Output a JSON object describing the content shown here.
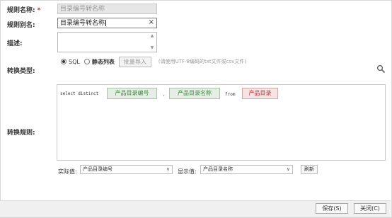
{
  "form": {
    "rule_name": {
      "label": "规则名称:",
      "required_mark": "*",
      "value": "目录编号转名称"
    },
    "rule_alias": {
      "label": "规则别名:",
      "value": "目录编号转名称",
      "clear": "×"
    },
    "description": {
      "label": "描述:",
      "value": ""
    },
    "convert_type": {
      "label": "转换类型:",
      "options": [
        "SQL",
        "静态列表"
      ],
      "selected": "SQL",
      "import_button": "批量导入",
      "hint": "(请使用UTF-8编码的txt文件或csv文件)"
    },
    "convert_rule": {
      "label": "转换规则:",
      "sql_keyword_select": "select distinct",
      "tag_field1": "产品目录编号",
      "comma": ",",
      "tag_field2": "产品目录名称",
      "sql_keyword_from": "from",
      "tag_table": "产品目录"
    },
    "actual_value": {
      "label": "实际值:",
      "value": "产品目录编号"
    },
    "display_value": {
      "label": "显示值:",
      "value": "产品目录名称"
    },
    "refresh_button": "刷新"
  },
  "footer": {
    "save_button": "保存(S)",
    "close_button": "关闭(C)"
  },
  "icons": {
    "search": "search-icon",
    "clear": "close-icon",
    "dropdown": "chevron-down-icon"
  },
  "colors": {
    "required": "#e02020",
    "tag_green_text": "#3a8a3a",
    "tag_red_text": "#d03030",
    "disabled_bg": "#e6e6e6"
  }
}
